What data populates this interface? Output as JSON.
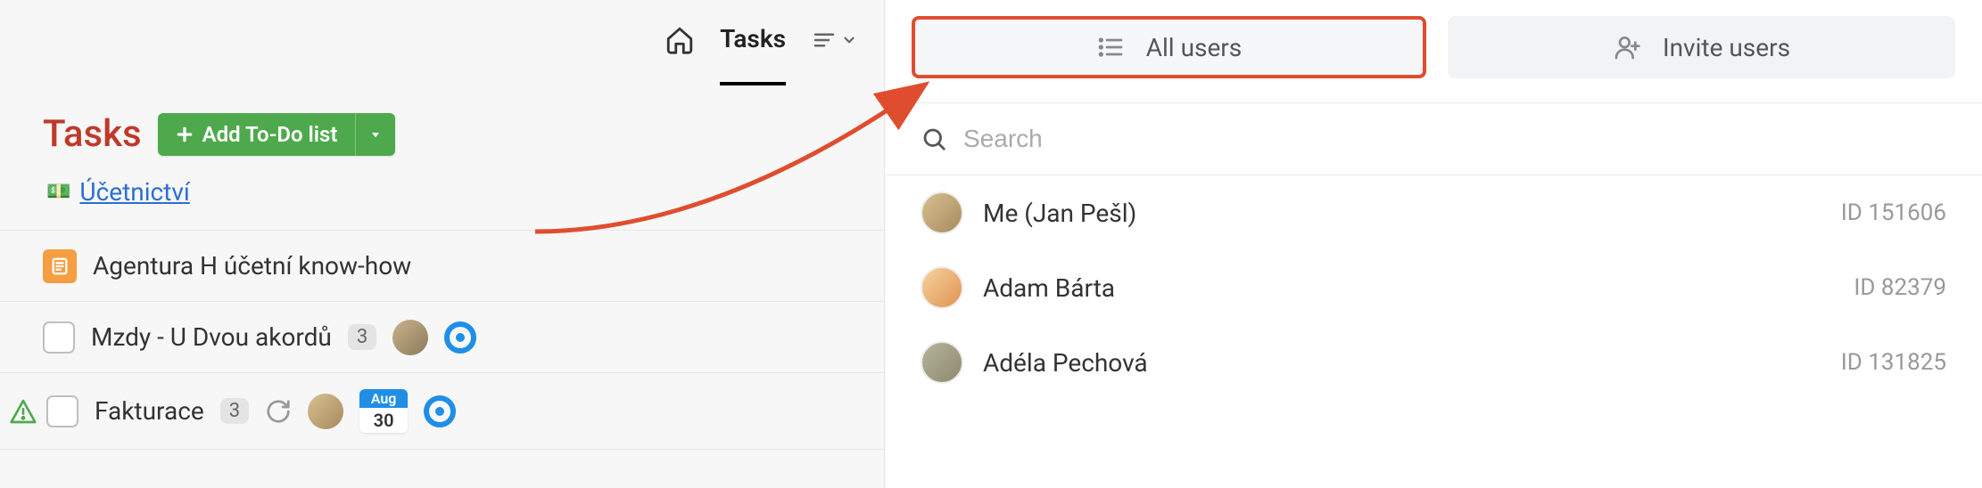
{
  "left": {
    "tasks_tab": "Tasks",
    "title": "Tasks",
    "add_todo_label": "Add To-Do list",
    "category": {
      "emoji": "💵",
      "name": "Účetnictví"
    },
    "tasks": [
      {
        "type": "note",
        "title": "Agentura H účetní know-how"
      },
      {
        "type": "checkbox",
        "title": "Mzdy - U Dvou akordů",
        "count": "3",
        "has_avatar": true,
        "has_target": true
      },
      {
        "type": "checkbox",
        "alert": true,
        "title": "Fakturace",
        "count": "3",
        "has_refresh": true,
        "has_avatar": true,
        "date": {
          "month": "Aug",
          "day": "30"
        },
        "has_target": true
      }
    ]
  },
  "right": {
    "tabs": {
      "all_users": "All users",
      "invite_users": "Invite users"
    },
    "search_placeholder": "Search",
    "users": [
      {
        "name": "Me (Jan Pešl)",
        "id": "ID 151606",
        "avatar_bg": "linear-gradient(135deg,#d9c08f,#a58a5f)"
      },
      {
        "name": "Adam Bárta",
        "id": "ID 82379",
        "avatar_bg": "linear-gradient(135deg,#f6d2a0,#e0934e)"
      },
      {
        "name": "Adéla Pechová",
        "id": "ID 131825",
        "avatar_bg": "linear-gradient(135deg,#b6b49b,#8c896e)"
      }
    ]
  }
}
